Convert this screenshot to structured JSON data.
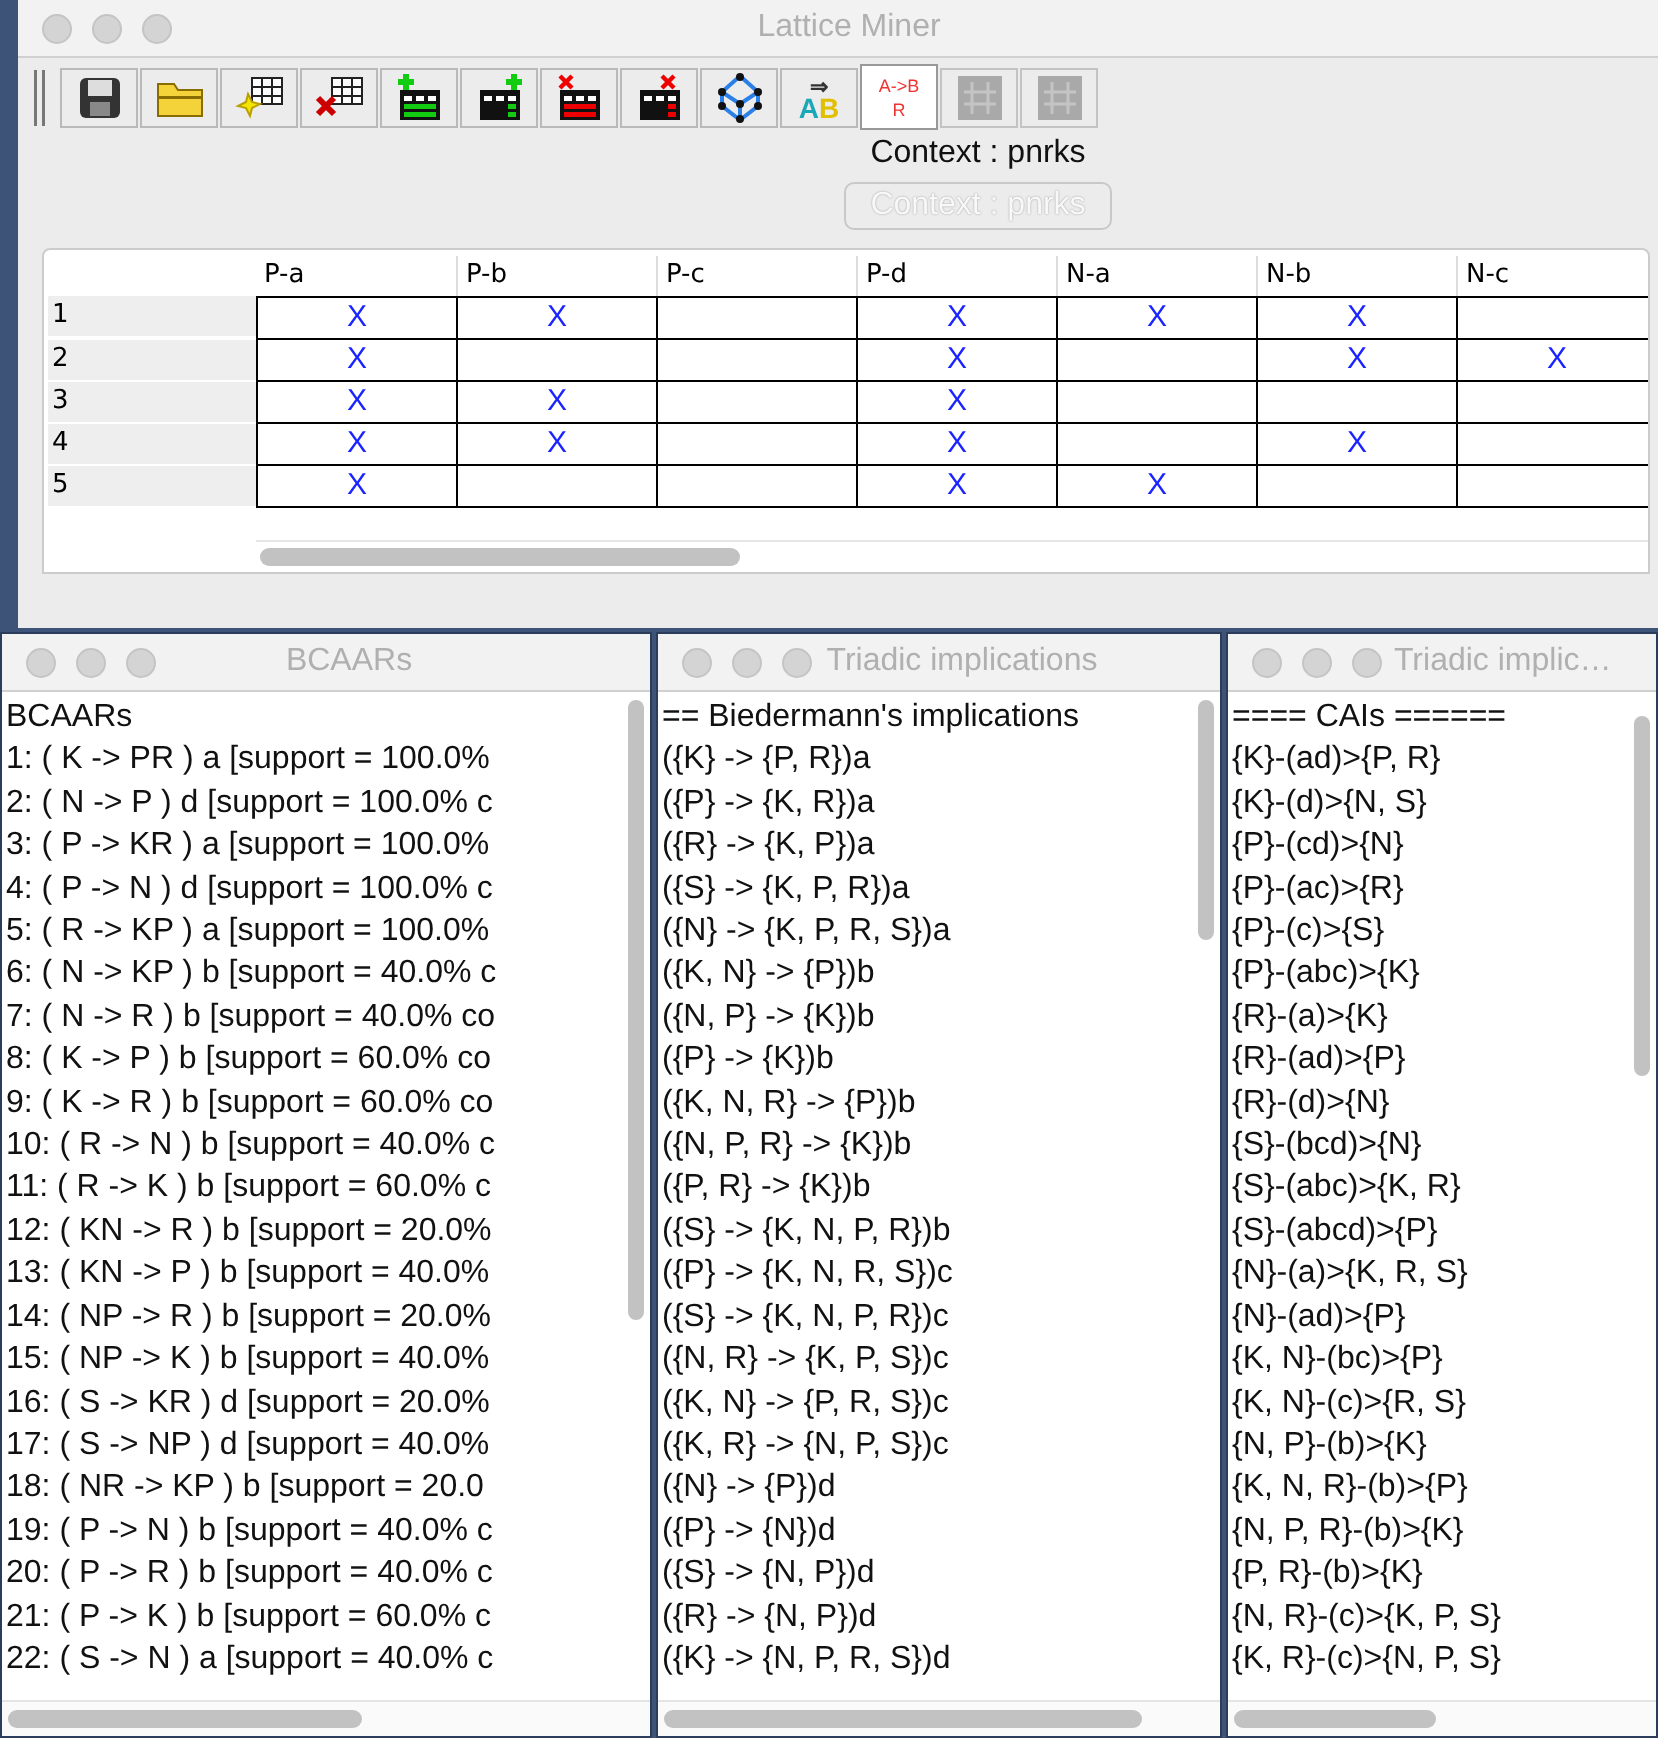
{
  "main_window": {
    "title": "Lattice Miner",
    "toolbar": [
      {
        "selected": false,
        "disabled": false
      },
      {
        "selected": false,
        "disabled": false
      },
      {
        "selected": false,
        "disabled": false
      },
      {
        "selected": false,
        "disabled": false
      },
      {
        "selected": false,
        "disabled": false
      },
      {
        "selected": false,
        "disabled": false
      },
      {
        "selected": false,
        "disabled": false
      },
      {
        "selected": false,
        "disabled": false
      },
      {
        "selected": false,
        "disabled": false
      },
      {
        "selected": false,
        "disabled": false,
        "arrow": "⇒",
        "letters": [
          "A",
          "B"
        ]
      },
      {
        "selected": true,
        "disabled": false,
        "label": "A->B",
        "sublabel": "R"
      },
      {
        "selected": false,
        "disabled": true
      },
      {
        "selected": false,
        "disabled": true
      }
    ],
    "context_label": "Context : pnrks",
    "context_button": {
      "label": "Context : pnrks",
      "disabled": true
    },
    "table": {
      "columns": [
        "P-a",
        "P-b",
        "P-c",
        "P-d",
        "N-a",
        "N-b",
        "N-c"
      ],
      "rows": [
        {
          "label": "1",
          "cells": [
            "X",
            "X",
            null,
            "X",
            "X",
            "X",
            null
          ]
        },
        {
          "label": "2",
          "cells": [
            "X",
            null,
            null,
            "X",
            null,
            "X",
            "X"
          ]
        },
        {
          "label": "3",
          "cells": [
            "X",
            "X",
            null,
            "X",
            null,
            null,
            null
          ]
        },
        {
          "label": "4",
          "cells": [
            "X",
            "X",
            null,
            "X",
            null,
            "X",
            null
          ]
        },
        {
          "label": "5",
          "cells": [
            "X",
            null,
            null,
            "X",
            "X",
            null,
            null
          ]
        }
      ]
    }
  },
  "panels": [
    {
      "title": "BCAARs",
      "lines": [
        "BCAARs",
        "1: ( K -> PR ) a [support = 100.0%",
        "2: ( N -> P ) d [support = 100.0% c",
        "3: ( P -> KR ) a [support = 100.0%",
        "4: ( P -> N ) d [support = 100.0% c",
        "5: ( R -> KP ) a [support = 100.0%",
        "6: ( N -> KP ) b [support = 40.0% c",
        "7: ( N -> R ) b [support = 40.0% co",
        "8: ( K -> P ) b [support = 60.0% co",
        "9: ( K -> R ) b [support = 60.0% co",
        "10: ( R -> N ) b [support = 40.0% c",
        "11: ( R -> K ) b [support = 60.0% c",
        "12: ( KN -> R ) b [support = 20.0%",
        "13: ( KN -> P ) b [support = 40.0%",
        "14: ( NP -> R ) b [support = 20.0%",
        "15: ( NP -> K ) b [support = 40.0%",
        "16: ( S -> KR ) d [support = 20.0%",
        "17: ( S -> NP ) d [support = 40.0%",
        "18: ( NR -> KP ) b [support = 20.0",
        "19: ( P -> N ) b [support = 40.0% c",
        "20: ( P -> R ) b [support = 40.0% c",
        "21: ( P -> K ) b [support = 60.0% c",
        "22: ( S -> N ) a [support = 40.0% c"
      ]
    },
    {
      "title": "Triadic implications",
      "lines": [
        "== Biedermann's implications",
        "({K} -> {P, R})a",
        "({P} -> {K, R})a",
        "({R} -> {K, P})a",
        "({S} -> {K, P, R})a",
        "({N} -> {K, P, R, S})a",
        "({K, N} -> {P})b",
        "({N, P} -> {K})b",
        "({P} -> {K})b",
        "({K, N, R} -> {P})b",
        "({N, P, R} -> {K})b",
        "({P, R} -> {K})b",
        "({S} -> {K, N, P, R})b",
        "({P} -> {K, N, R, S})c",
        "({S} -> {K, N, P, R})c",
        "({N, R} -> {K, P, S})c",
        "({K, N} -> {P, R, S})c",
        "({K, R} -> {N, P, S})c",
        "({N} -> {P})d",
        "({P} -> {N})d",
        "({S} -> {N, P})d",
        "({R} -> {N, P})d",
        "({K} -> {N, P, R, S})d"
      ]
    },
    {
      "title": "Triadic implic…",
      "lines": [
        "==== CAIs ======",
        "{K}-(ad)>{P, R}",
        "{K}-(d)>{N, S}",
        "{P}-(cd)>{N}",
        "{P}-(ac)>{R}",
        "{P}-(c)>{S}",
        "{P}-(abc)>{K}",
        "{R}-(a)>{K}",
        "{R}-(ad)>{P}",
        "{R}-(d)>{N}",
        "{S}-(bcd)>{N}",
        "{S}-(abc)>{K, R}",
        "{S}-(abcd)>{P}",
        "{N}-(a)>{K, R, S}",
        "{N}-(ad)>{P}",
        "{K, N}-(bc)>{P}",
        "{K, N}-(c)>{R, S}",
        "{N, P}-(b)>{K}",
        "{K, N, R}-(b)>{P}",
        "{N, P, R}-(b)>{K}",
        "{P, R}-(b)>{K}",
        "{N, R}-(c)>{K, P, S}",
        "{K, R}-(c)>{N, P, S}"
      ]
    }
  ]
}
